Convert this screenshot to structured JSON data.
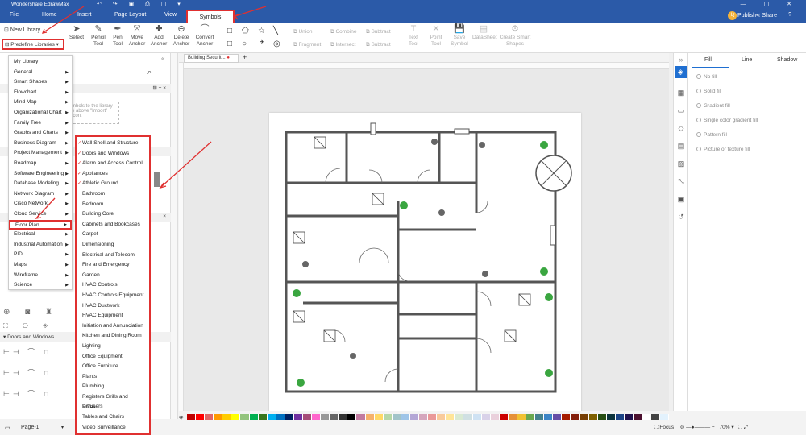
{
  "app": {
    "title": "Wondershare EdrawMax"
  },
  "menubar": {
    "items": [
      "File",
      "Home",
      "Insert",
      "Page Layout",
      "View",
      "Symbols"
    ],
    "publish": "Publish",
    "share": "Share",
    "help": "?",
    "avatar": "L"
  },
  "toolbar": {
    "select": "Select",
    "pencil": "Pencil Tool",
    "pen": "Pen Tool",
    "move_anchor": "Move Anchor",
    "add_anchor": "Add Anchor",
    "delete_anchor": "Delete Anchor",
    "convert_anchor": "Convert Anchor",
    "union": "Union",
    "combine": "Combine",
    "subtract": "Subtract",
    "fragment": "Fragment",
    "intersect": "Intersect",
    "subtract2": "Subtract",
    "text_tool": "Text Tool",
    "point_tool": "Point Tool",
    "save_symbol": "Save Symbol",
    "datasheet": "DataSheet",
    "create_smart_shapes": "Create Smart Shapes"
  },
  "libraries": {
    "new_library": "New Library",
    "predefine": "Predefine Libraries"
  },
  "dropdown": {
    "items": [
      "My Library",
      "General",
      "Smart Shapes",
      "Flowchart",
      "Mind Map",
      "Organizational Chart",
      "Family Tree",
      "Graphs and Charts",
      "Business Diagram",
      "Project Management",
      "Roadmap",
      "Software Engineering",
      "Database Modeling",
      "Network Diagram",
      "Cisco Network",
      "Cloud Service",
      "Floor Plan",
      "Electrical",
      "Industrial Automation",
      "PID",
      "Maps",
      "Wireframe",
      "Science"
    ]
  },
  "submenu": {
    "items": [
      "Wall Shell and Structure",
      "Doors and Windows",
      "Alarm and Access Control",
      "Appliances",
      "Athletic Ground",
      "Bathroom",
      "Bedroom",
      "Building Core",
      "Cabinets and Bookcases",
      "Carpet",
      "Dimensioning",
      "Electrical and Telecom",
      "Fire and Emergency",
      "Garden",
      "HVAC Controls",
      "HVAC Controls Equipment",
      "HVAC Ductwork",
      "HVAC Equipment",
      "Initiation and Annunciation",
      "Kitchen and Dining Room",
      "Lighting",
      "Office Equipment",
      "Office Furniture",
      "Plants",
      "Plumbing",
      "Registers Grills and Diffusers",
      "Sofas",
      "Tables and Chairs",
      "Video Surveillance"
    ],
    "checked": [
      0,
      1,
      2,
      3,
      4
    ]
  },
  "leftpanel": {
    "drag_hint_1": "mbols to the library",
    "drag_hint_2": "e above \"Import\"",
    "drag_hint_3": "icon.",
    "section_doors": "Doors and Windows",
    "page_name": "Page-1"
  },
  "canvas": {
    "tab_name": "Building Securit..."
  },
  "rightpanel": {
    "tabs": [
      "Fill",
      "Line",
      "Shadow"
    ],
    "options": [
      "No fill",
      "Solid fill",
      "Gradient fill",
      "Single color gradient fill",
      "Pattern fill",
      "Picture or texture fill"
    ]
  },
  "status": {
    "focus": "Focus",
    "zoom": "70%"
  },
  "colors": {
    "accent": "#2b5aa8",
    "highlight": "#e03030",
    "palette": [
      "#c00000",
      "#ff0000",
      "#e06666",
      "#ff9900",
      "#ffcc00",
      "#ffff00",
      "#93c47d",
      "#00b050",
      "#38761d",
      "#00b0f0",
      "#0070c0",
      "#002060",
      "#7030a0",
      "#a64d79",
      "#ff66cc",
      "#999999",
      "#666666",
      "#333333",
      "#000000",
      "#c27ba0",
      "#f6b26b",
      "#ffd966",
      "#b6d7a8",
      "#a2c4c9",
      "#9fc5e8",
      "#b4a7d6",
      "#d5a6bd",
      "#ea9999",
      "#f9cb9c",
      "#ffe599",
      "#d9ead3",
      "#d0e0e3",
      "#cfe2f3",
      "#d9d2e9",
      "#ead1dc",
      "#cc0000",
      "#e69138",
      "#f1c232",
      "#6aa84f",
      "#45818e",
      "#3d85c6",
      "#674ea7",
      "#a61c00",
      "#85200c",
      "#783f04",
      "#7f6000",
      "#274e13",
      "#0c343d",
      "#1c4587",
      "#20124d",
      "#4c1130",
      "#ffffff",
      "#444444",
      "#e3f2fd"
    ]
  }
}
